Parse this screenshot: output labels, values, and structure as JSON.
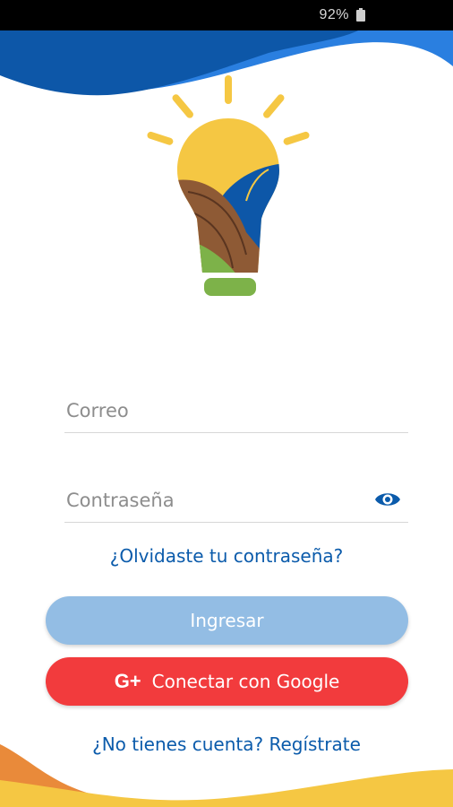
{
  "status_bar": {
    "battery_text": "92%",
    "battery_icon": "battery-icon"
  },
  "form": {
    "email_placeholder": "Correo",
    "password_placeholder": "Contraseña",
    "show_password_icon": "eye-icon"
  },
  "links": {
    "forgot_password": "¿Olvidaste tu contraseña?",
    "signup": "¿No tienes cuenta? Regístrate"
  },
  "buttons": {
    "login_label": "Ingresar",
    "google_icon": "G+",
    "google_label": "Conectar con Google"
  },
  "colors": {
    "primary_blue": "#0b5bab",
    "login_button": "#93bde4",
    "google_button": "#f23b3d",
    "wave_blue": "#0d57a8",
    "wave_yellow": "#f5c743",
    "wave_orange": "#e98a3a"
  }
}
